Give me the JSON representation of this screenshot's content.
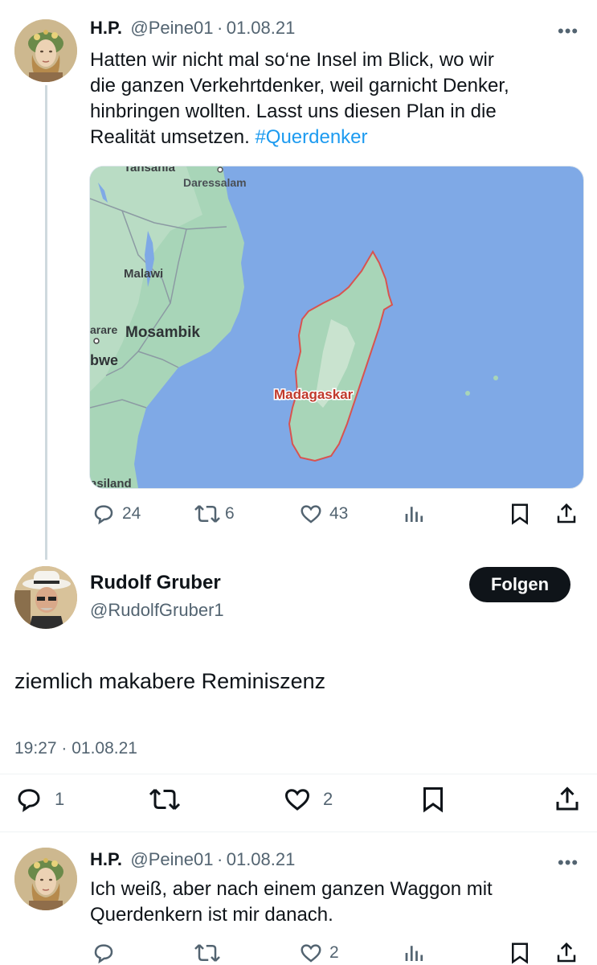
{
  "tweet1": {
    "name": "H.P.",
    "handle": "@Peine01",
    "sep": "·",
    "date": "01.08.21",
    "more": "•••",
    "text_lines": [
      "Hatten wir nicht mal so‘ne Insel im Blick, wo wir",
      "die ganzen Verkehrtdenker, weil garnicht Denker,",
      "hinbringen wollten. Lasst uns diesen Plan in die",
      "Realität umsetzen. "
    ],
    "hashtag": "#Querdenker",
    "map_labels": {
      "tansania": "Tansania",
      "daressalam": "Daressalam",
      "malawi": "Malawi",
      "harare": "arare",
      "mosambik": "Mosambik",
      "simbabwe": "bwe",
      "madagaskar": "Madagaskar",
      "swasiland": "asiland"
    },
    "actions": {
      "reply_count": "24",
      "retweet_count": "6",
      "like_count": "43"
    }
  },
  "tweet2": {
    "name": "Rudolf Gruber",
    "handle": "@RudolfGruber1",
    "follow_label": "Folgen",
    "text": "ziemlich makabere Reminiszenz",
    "timestamp": "19:27 · 01.08.21",
    "actions": {
      "reply_count": "1",
      "like_count": "2"
    }
  },
  "tweet3": {
    "name": "H.P.",
    "handle": "@Peine01",
    "sep": "·",
    "date": "01.08.21",
    "more": "•••",
    "text_lines": [
      "Ich weiß, aber nach einem ganzen Waggon mit",
      "Querdenkern ist mir danach."
    ],
    "actions": {
      "like_count": "2"
    }
  },
  "colors": {
    "accent": "#1d9bf0",
    "text": "#0f1419",
    "secondary": "#536471",
    "map_ocean": "#7fa9e6",
    "map_land": "#a8d5b8",
    "madagascar_border": "#d9534f"
  }
}
